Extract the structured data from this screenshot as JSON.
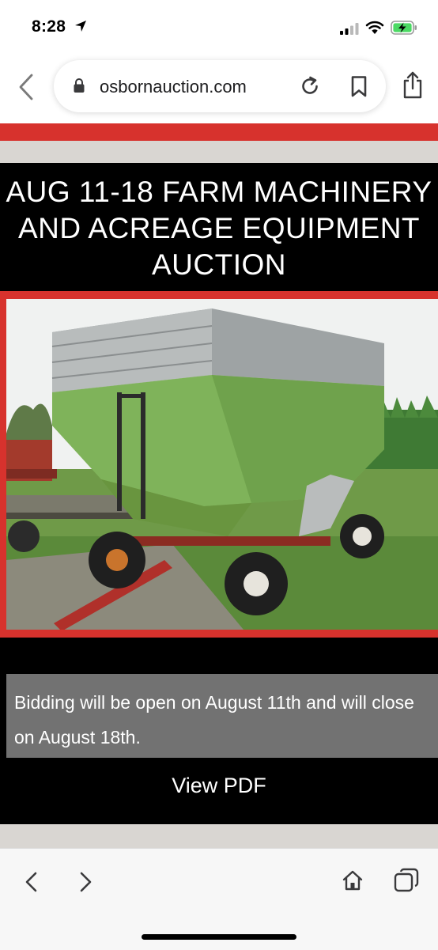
{
  "status": {
    "time": "8:28"
  },
  "browser": {
    "url": "osbornauction.com"
  },
  "page": {
    "title": "AUG 11-18 FARM MACHINERY AND ACREAGE EQUIPMENT AUCTION",
    "bidding_text": "Bidding will be open on August 11th and will close on August 18th.",
    "view_pdf_label": "View PDF"
  },
  "colors": {
    "accent_red": "#d7322d",
    "band_gray": "#d9d6d2",
    "title_bg": "#000000",
    "bid_box": "#727272"
  },
  "icons": {
    "status": [
      "location-arrow-icon",
      "signal-icon",
      "wifi-icon",
      "battery-charging-icon"
    ],
    "browser": [
      "back-chevron-icon",
      "lock-icon",
      "reload-icon",
      "bookmark-icon",
      "share-icon"
    ],
    "toolbar": [
      "back-icon",
      "forward-icon",
      "home-icon",
      "tabs-icon"
    ]
  }
}
